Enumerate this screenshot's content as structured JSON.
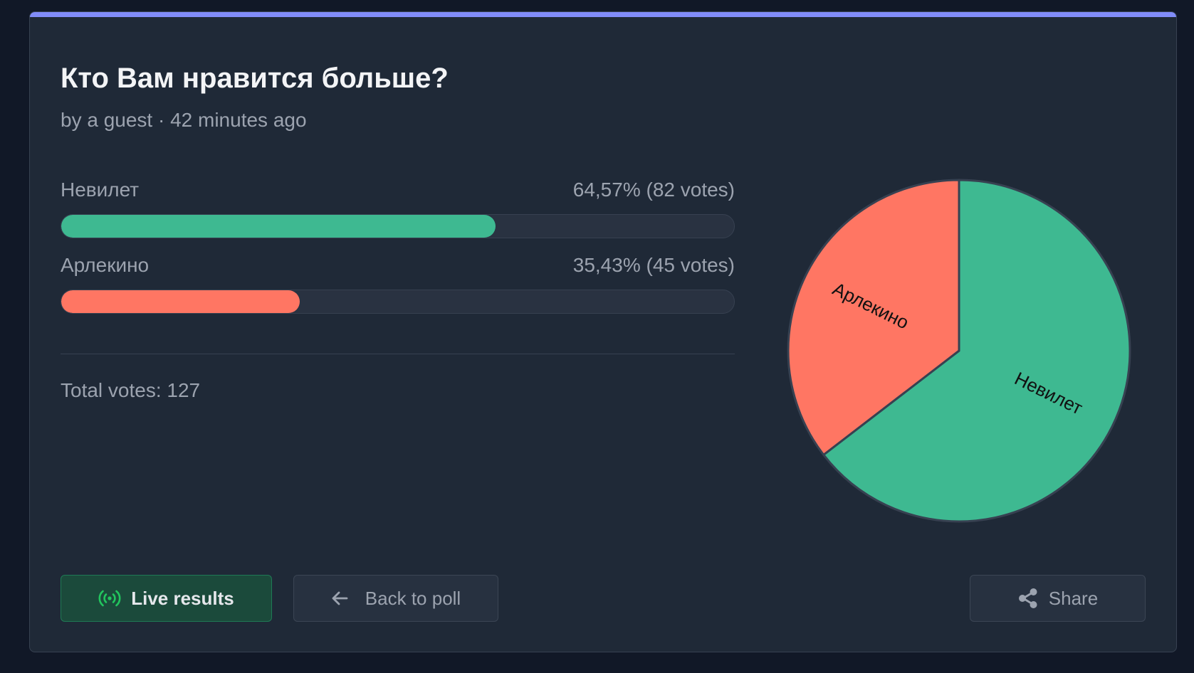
{
  "poll": {
    "title": "Кто Вам нравится больше?",
    "meta": "by a guest · 42 minutes ago",
    "options": [
      {
        "label": "Невилет",
        "result": "64,57% (82 votes)",
        "percent": 64.57,
        "votes": 82,
        "color": "#3eb991"
      },
      {
        "label": "Арлекино",
        "result": "35,43% (45 votes)",
        "percent": 35.43,
        "votes": 45,
        "color": "#ff7663"
      }
    ],
    "total": "Total votes: 127"
  },
  "chart_data": {
    "type": "pie",
    "categories": [
      "Невилет",
      "Арлекино"
    ],
    "values": [
      82,
      45
    ],
    "colors": [
      "#3eb991",
      "#ff7663"
    ]
  },
  "buttons": {
    "live_label": "Live results",
    "back_label": "Back to poll",
    "share_label": "Share"
  },
  "icons": {
    "live": "broadcast-icon",
    "back": "arrow-left-icon",
    "share": "share-icon"
  },
  "theme": {
    "accent": "#818cf8",
    "background": "#111827",
    "card": "#1f2937"
  }
}
